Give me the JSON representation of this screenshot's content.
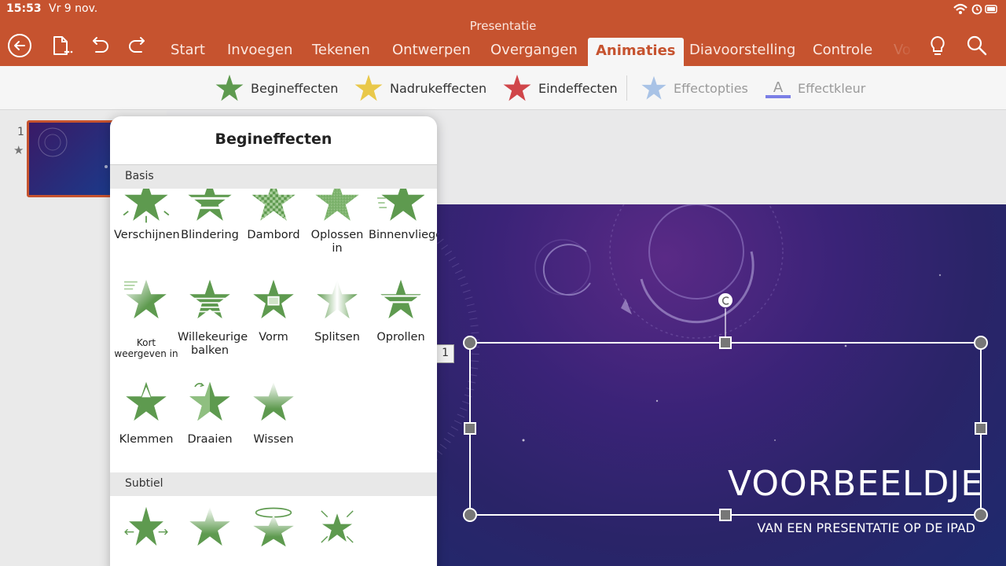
{
  "status": {
    "time": "15:53",
    "date": "Vr 9 nov."
  },
  "document": {
    "title": "Presentatie"
  },
  "tabs": [
    {
      "id": "start",
      "label": "Start"
    },
    {
      "id": "invoegen",
      "label": "Invoegen"
    },
    {
      "id": "tekenen",
      "label": "Tekenen"
    },
    {
      "id": "ontwerpen",
      "label": "Ontwerpen"
    },
    {
      "id": "overgangen",
      "label": "Overgangen"
    },
    {
      "id": "animaties",
      "label": "Animaties"
    },
    {
      "id": "diavoorstelling",
      "label": "Diavoorstelling"
    },
    {
      "id": "controle",
      "label": "Controle"
    },
    {
      "id": "weergave",
      "label": "Vo"
    }
  ],
  "ribbon": {
    "begin": "Begineffecten",
    "nadruk": "Nadrukeffecten",
    "eind": "Eindeffecten",
    "effectopties": "Effectopties",
    "effectkleur": "Effectkleur",
    "effectkleur_glyph": "A"
  },
  "colors": {
    "accent": "#c6532f",
    "green": "#5e9a4f",
    "yellow": "#e9c84a",
    "red": "#d0464a",
    "blue_disabled": "#a9c3e6"
  },
  "thumbnails": {
    "slide_number": "1",
    "animation_marker": "★"
  },
  "popover": {
    "title": "Begineffecten",
    "sections": [
      {
        "name": "Basis",
        "effects": [
          "Verschijnen",
          "Blindering",
          "Dambord",
          "Oplossen in",
          "Binnenvliegen",
          "Kort weergeven in",
          "Willekeurige balken",
          "Vorm",
          "Splitsen",
          "Oprollen",
          "Klemmen",
          "Draaien",
          "Wissen"
        ]
      },
      {
        "name": "Subtiel",
        "effects": []
      }
    ]
  },
  "slide": {
    "title": "VOORBEELDJE",
    "subtitle": "VAN EEN PRESENTATIE OP DE IPAD",
    "animation_order": "1"
  }
}
